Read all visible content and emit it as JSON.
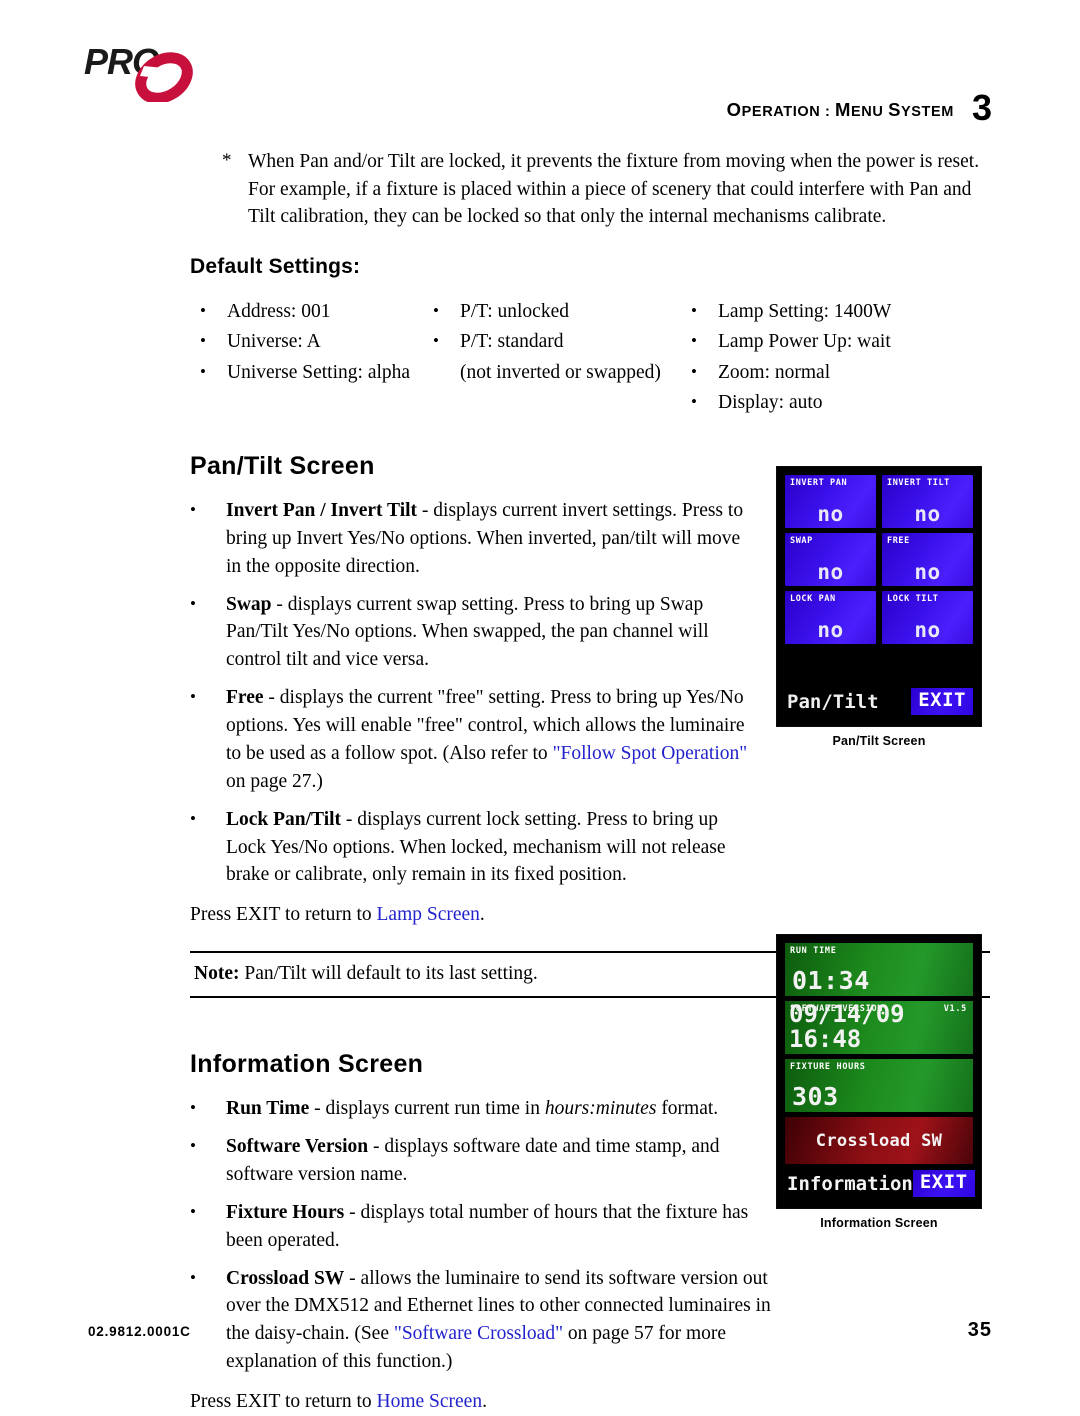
{
  "header": {
    "logo_text": "PRG",
    "title_prefix": "O",
    "title": "OPERATION : MENU SYSTEM",
    "title_parts": [
      "O",
      "PERATION",
      " : ",
      "M",
      "ENU ",
      "S",
      "YSTEM"
    ],
    "chapter": "3"
  },
  "intro": {
    "marker": "*",
    "text": "When Pan and/or Tilt are locked, it prevents the fixture from moving when the power is reset. For example, if a fixture is placed within a piece of scenery that could interfere with Pan and Tilt calibration, they can be locked so that only the internal mechanisms calibrate."
  },
  "defaults": {
    "heading": "Default Settings:",
    "bullet": "•",
    "column1": [
      "Address: 001",
      "Universe: A",
      "Universe Setting: alpha"
    ],
    "column2": [
      "P/T: unlocked",
      "P/T: standard"
    ],
    "column2_sub": "(not inverted or swapped)",
    "column3": [
      "Lamp Setting: 1400W",
      "Lamp Power Up: wait",
      "Zoom: normal",
      "Display: auto"
    ]
  },
  "pantilt_section": {
    "title": "Pan/Tilt Screen",
    "bullets": [
      {
        "lead": "Invert Pan / Invert Tilt",
        "body": " - displays current invert settings. Press to bring up Invert Yes/No options. When inverted, pan/tilt will move in the opposite direction."
      },
      {
        "lead": "Swap",
        "body": " - displays current swap setting. Press to bring up Swap Pan/Tilt Yes/No options. When swapped, the pan channel will control tilt and vice versa."
      },
      {
        "lead": "Free",
        "body_before": " - displays the current \"free\" setting. Press to bring up Yes/No options. Yes will enable \"free\" control, which allows the luminaire to be used as a follow spot. (Also refer to ",
        "link": "\"Follow Spot Operation\"",
        "body_after": " on page 27.)"
      },
      {
        "lead": "Lock Pan/Tilt",
        "body": " - displays current lock setting. Press to bring up Lock Yes/No options. When locked, mechanism will not release brake or calibrate, only remain in its fixed position."
      }
    ],
    "exit_note_before": "Press EXIT to return to ",
    "exit_note_link": "Lamp Screen",
    "exit_note_after": ".",
    "note_label": "Note:",
    "note_text": "Pan/Tilt will default to its last setting."
  },
  "pantilt_lcd": {
    "caption": "Pan/Tilt Screen",
    "buttons": [
      {
        "label": "INVERT PAN",
        "value": "no"
      },
      {
        "label": "INVERT TILT",
        "value": "no"
      },
      {
        "label": "SWAP",
        "value": "no"
      },
      {
        "label": "FREE",
        "value": "no"
      },
      {
        "label": "LOCK PAN",
        "value": "no"
      },
      {
        "label": "LOCK TILT",
        "value": "no"
      }
    ],
    "screen_name": "Pan/Tilt",
    "exit_label": "EXIT",
    "colors": {
      "background": "#000000",
      "button_blue": "#3a10ea",
      "exit_blue": "#3c12f4",
      "text": "#ffffff"
    }
  },
  "information_section": {
    "title": "Information Screen",
    "bullets": [
      {
        "lead": "Run Time",
        "body_before": " - displays current run time in ",
        "italic": "hours:minutes",
        "body_after": " format."
      },
      {
        "lead": "Software Version",
        "body": " - displays software date and time stamp, and software version name."
      },
      {
        "lead": "Fixture Hours",
        "body": " - displays total number of hours that the fixture has been operated."
      },
      {
        "lead": "Crossload SW",
        "body_before": " - allows the luminaire to send its software version out over the DMX512 and Ethernet lines to other connected luminaires in the daisy-chain. (See ",
        "link": "\"Software Crossload\"",
        "body_after": " on page 57 for more explanation of this function.)"
      }
    ],
    "exit_note_before": "Press EXIT to return to ",
    "exit_note_link": "Home Screen",
    "exit_note_after": "."
  },
  "information_lcd": {
    "caption": "Information Screen",
    "panels": [
      {
        "label": "RUN TIME",
        "label_right": "",
        "value": "01:34"
      },
      {
        "label": "SOFTWARE VERSION",
        "label_right": "V1.5",
        "value": "09/14/09 16:48"
      },
      {
        "label": "FIXTURE HOURS",
        "label_right": "",
        "value": "303"
      }
    ],
    "crossload_label": "Crossload SW",
    "screen_name": "Information",
    "exit_label": "EXIT",
    "colors": {
      "background": "#000000",
      "panel_green": "#1d8b1d",
      "crossload_red": "#8c0f14",
      "exit_blue": "#3c12f4"
    }
  },
  "footer": {
    "doc_id": "02.9812.0001C",
    "page_number": "35"
  },
  "theme": {
    "link_blue": "#2222cc",
    "brand_red": "#c8103c",
    "text_black": "#000000"
  }
}
